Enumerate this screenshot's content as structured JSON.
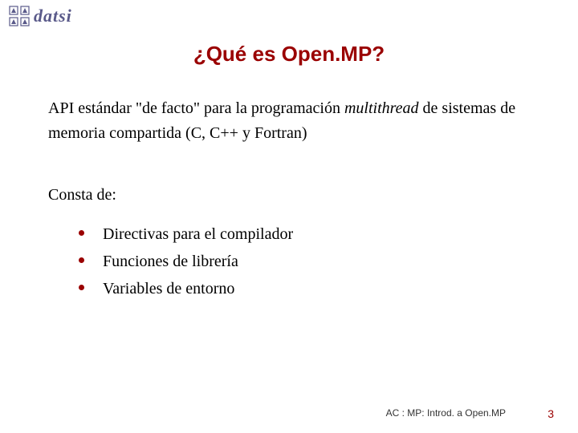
{
  "logo": {
    "text": "datsi"
  },
  "title": "¿Qué es Open.MP?",
  "description": {
    "pre": "API estándar \"de facto\" para la programación ",
    "italic": "multithread",
    "post": " de sistemas de memoria compartida (C, C++ y Fortran)"
  },
  "consta_label": "Consta de:",
  "bullets": [
    "Directivas para el compilador",
    "Funciones de librería",
    "Variables de entorno"
  ],
  "footer": "AC : MP: Introd. a Open.MP",
  "page_number": "3"
}
